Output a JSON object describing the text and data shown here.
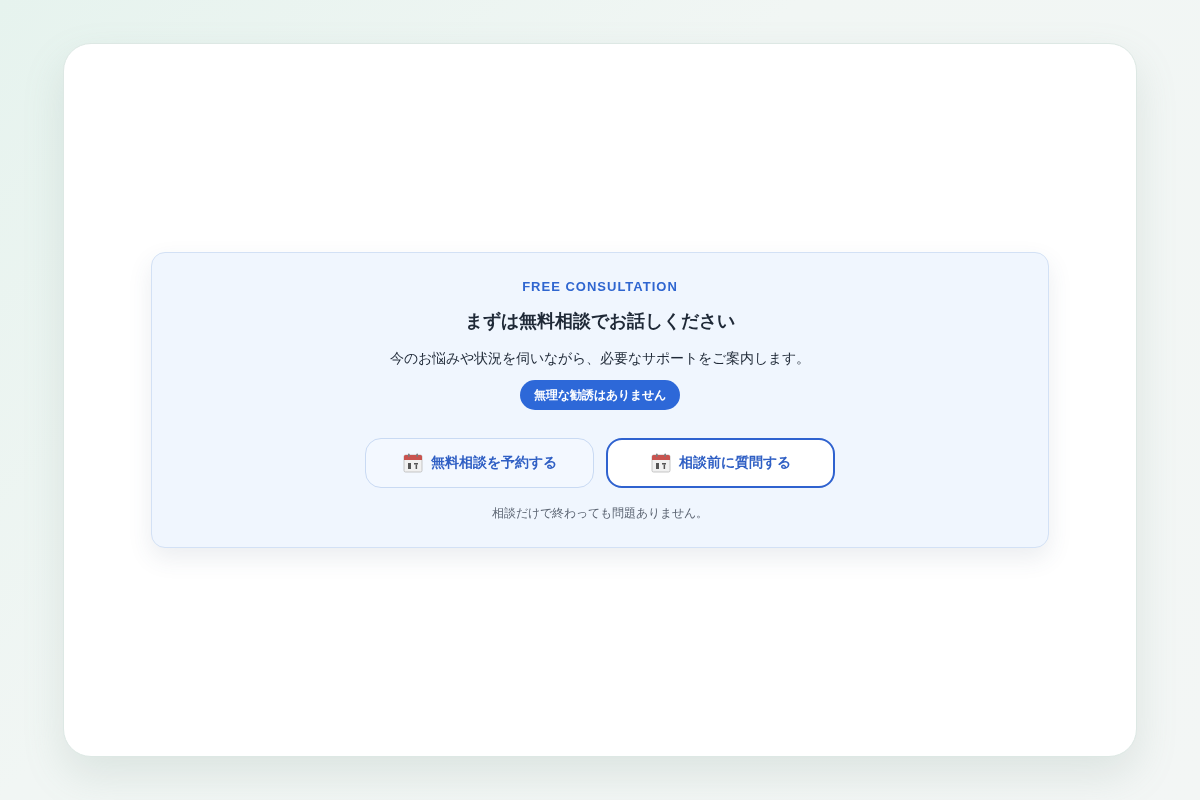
{
  "cta": {
    "eyebrow": "FREE CONSULTATION",
    "title": "まずは無料相談でお話しください",
    "lead": "今のお悩みや状況を伺いながら、必要なサポートをご案内します。",
    "badge": "無理な勧誘はありません",
    "buttons": [
      {
        "label": "無料相談を予約する",
        "kind": "soft"
      },
      {
        "label": "相談前に質問する",
        "kind": "outline"
      }
    ],
    "note": "相談だけで終わっても問題ありません。"
  }
}
